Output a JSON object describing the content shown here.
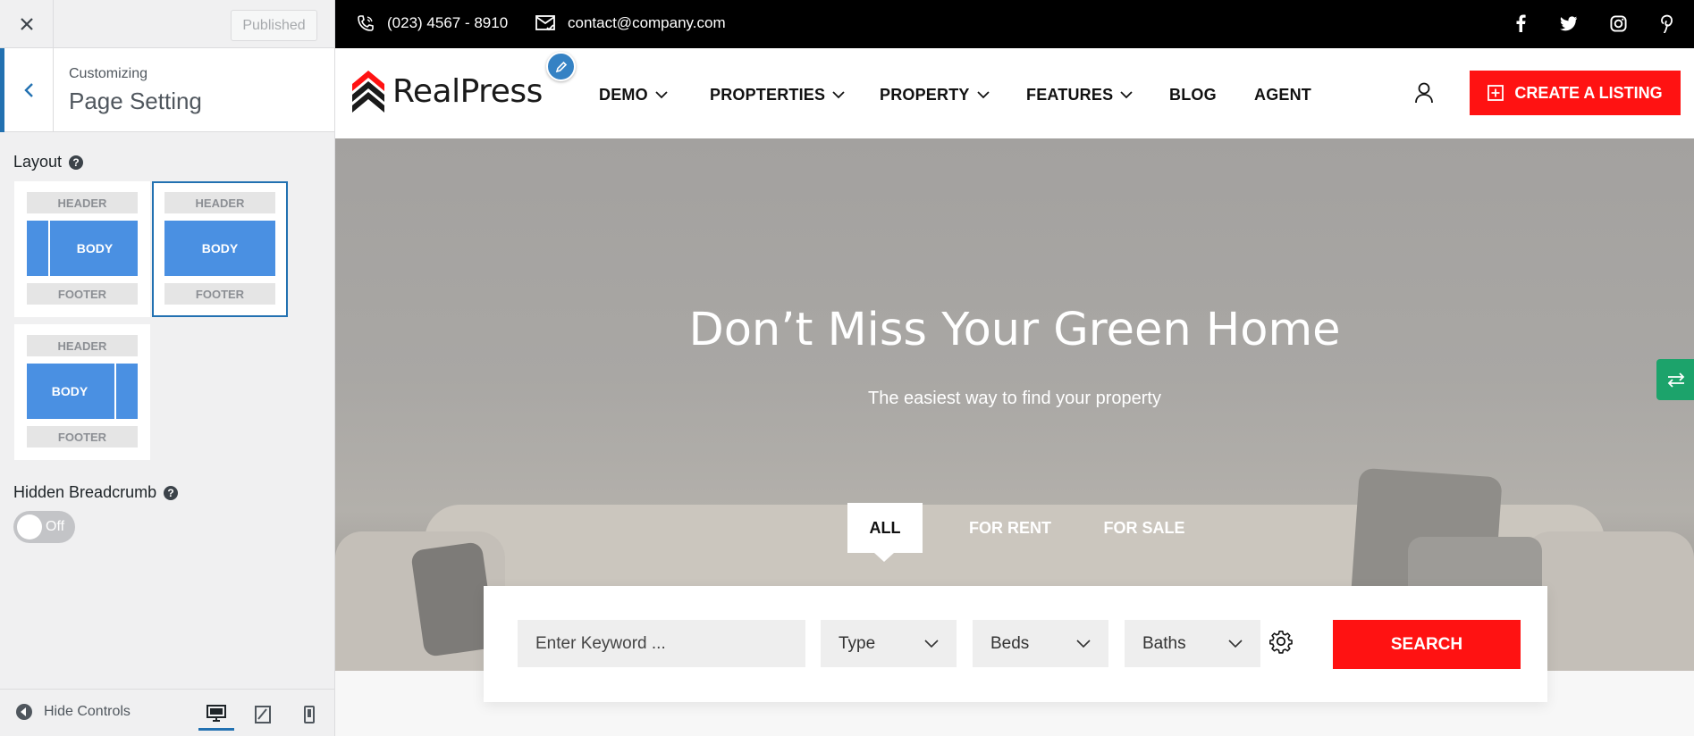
{
  "customizer": {
    "published_label": "Published",
    "customizing_label": "Customizing",
    "section_title": "Page Setting",
    "layout_label": "Layout",
    "layout_options": [
      {
        "header": "HEADER",
        "body": "BODY",
        "footer": "FOOTER",
        "sidebar": "left",
        "selected": false
      },
      {
        "header": "HEADER",
        "body": "BODY",
        "footer": "FOOTER",
        "sidebar": "none",
        "selected": true
      },
      {
        "header": "HEADER",
        "body": "BODY",
        "footer": "FOOTER",
        "sidebar": "right",
        "selected": false
      }
    ],
    "breadcrumb_label": "Hidden Breadcrumb",
    "breadcrumb_toggle": "Off",
    "hide_controls_label": "Hide Controls",
    "devices": [
      "desktop-icon",
      "tablet-icon",
      "mobile-icon"
    ],
    "accent_color": "#2271b1"
  },
  "site": {
    "topbar": {
      "phone": "(023) 4567 - 8910",
      "email": "contact@company.com",
      "social": [
        "facebook-icon",
        "twitter-icon",
        "instagram-icon",
        "pinterest-icon"
      ]
    },
    "logo_text": "RealPress",
    "nav": [
      {
        "label": "DEMO",
        "dropdown": true
      },
      {
        "label": "PROPTERTIES",
        "dropdown": true
      },
      {
        "label": "PROPERTY",
        "dropdown": true
      },
      {
        "label": "FEATURES",
        "dropdown": true
      },
      {
        "label": "BLOG",
        "dropdown": false
      },
      {
        "label": "AGENT",
        "dropdown": false
      }
    ],
    "create_listing_label": "CREATE A LISTING",
    "hero": {
      "title": "Don’t Miss Your Green Home",
      "subtitle": "The easiest way to find your property"
    },
    "tabs": [
      {
        "label": "ALL",
        "active": true
      },
      {
        "label": "FOR RENT",
        "active": false
      },
      {
        "label": "FOR SALE",
        "active": false
      }
    ],
    "search": {
      "keyword_placeholder": "Enter Keyword ...",
      "type_label": "Type",
      "beds_label": "Beds",
      "baths_label": "Baths",
      "button_label": "SEARCH"
    },
    "brand_red": "#ff1212",
    "switch_color": "#1ca36b"
  }
}
